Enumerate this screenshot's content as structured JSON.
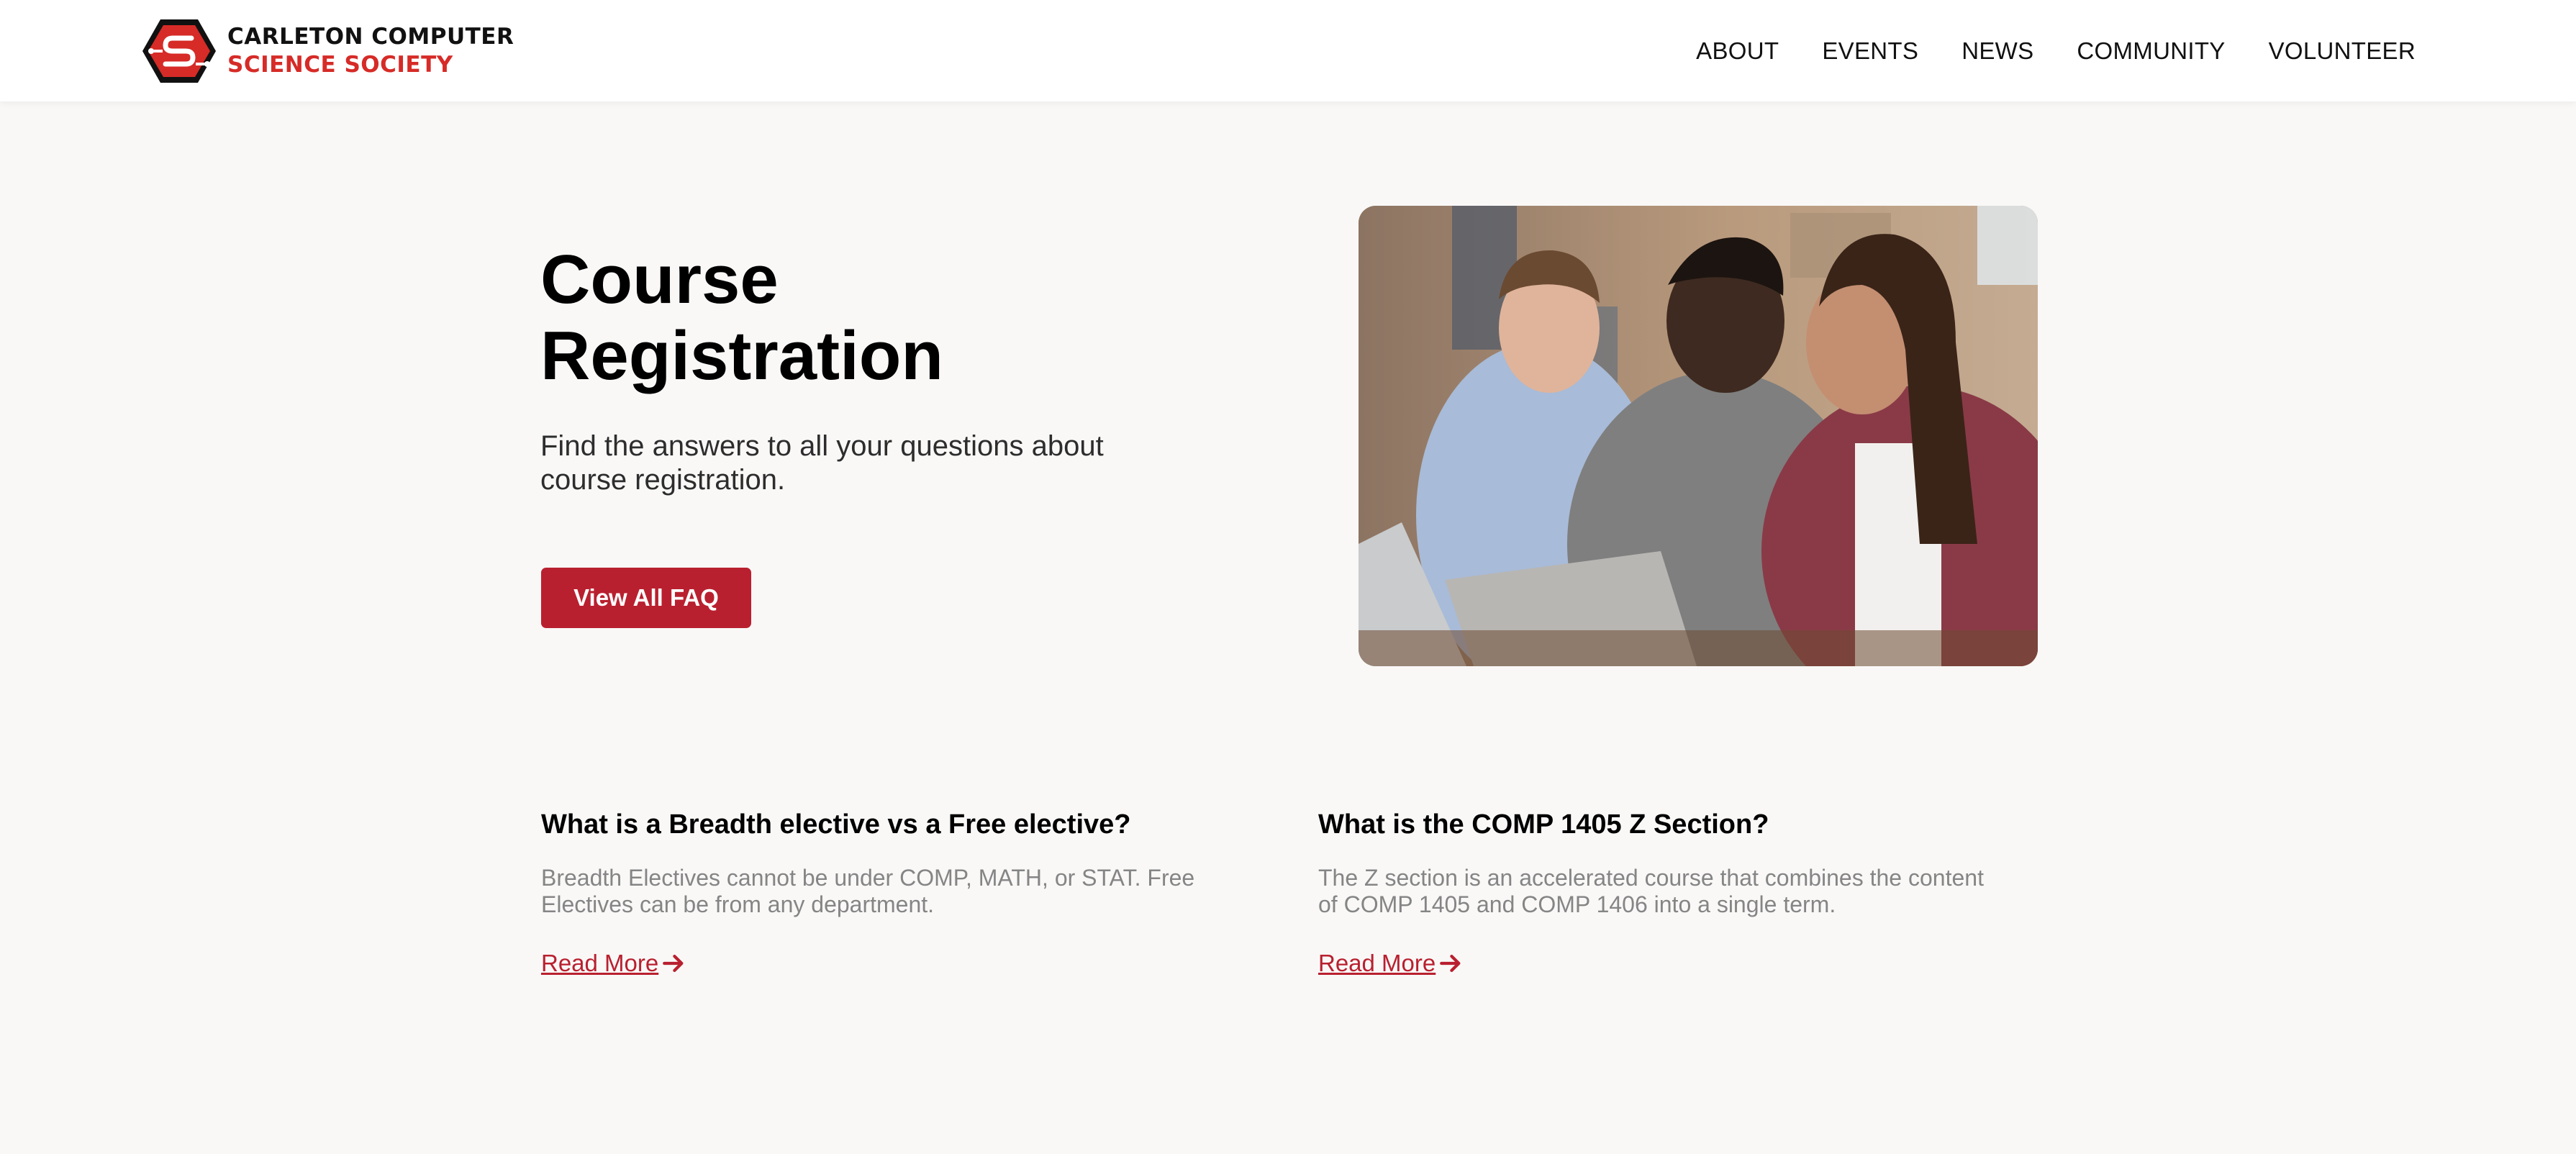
{
  "brand": {
    "line1": "CARLETON COMPUTER",
    "line2": "SCIENCE SOCIETY",
    "logo_icon": "cs-hexagon-logo-icon",
    "colors": {
      "red": "#d62b27",
      "dark": "#111111"
    }
  },
  "nav": {
    "items": [
      {
        "label": "ABOUT"
      },
      {
        "label": "EVENTS"
      },
      {
        "label": "NEWS"
      },
      {
        "label": "COMMUNITY"
      },
      {
        "label": "VOLUNTEER"
      }
    ]
  },
  "hero": {
    "title": "Course Registration",
    "subtitle": "Find the answers to all your questions about course registration.",
    "button_label": "View All FAQ",
    "accent": "#b9202f"
  },
  "faqs": [
    {
      "question": "What is a Breadth elective vs a Free elective?",
      "answer": "Breadth Electives cannot be under COMP, MATH, or STAT. Free Electives can be from any department.",
      "link_label": "Read More ",
      "link_icon": "arrow-right-icon"
    },
    {
      "question": "What is the COMP 1405 Z Section?",
      "answer": "The Z section is an accelerated course that combines the content of COMP 1405 and COMP 1406 into a single term.",
      "link_label": "Read More ",
      "link_icon": "arrow-right-icon"
    }
  ]
}
